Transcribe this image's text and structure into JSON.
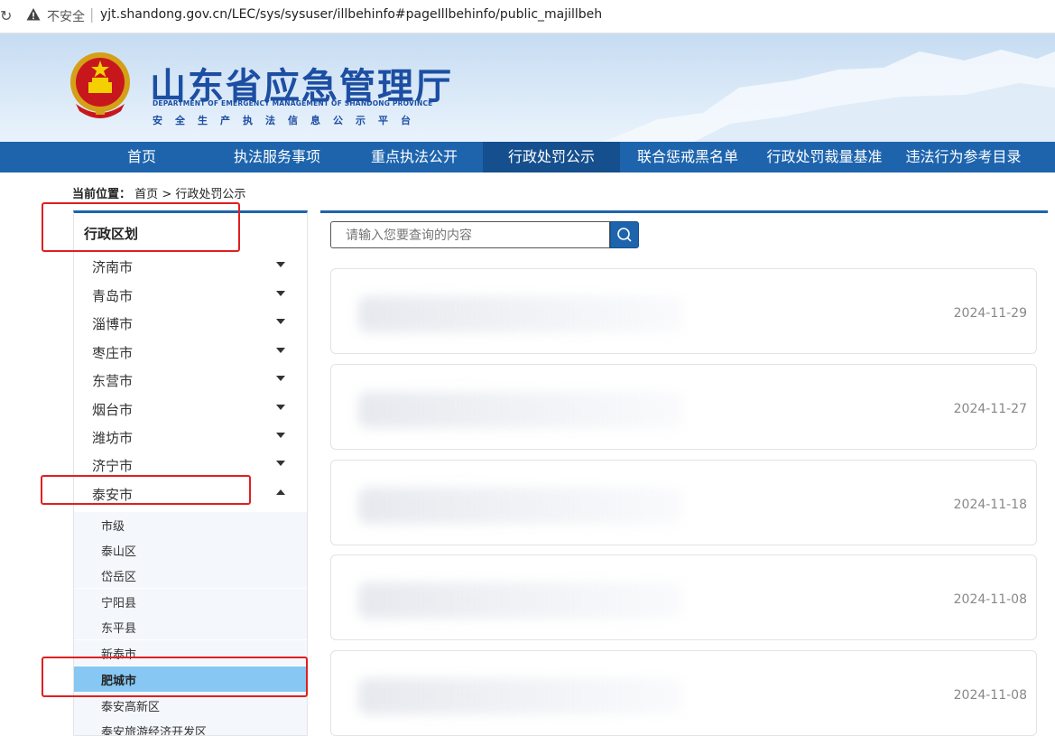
{
  "browser": {
    "insecure_label": "不安全",
    "separator": "|",
    "url": "yjt.shandong.gov.cn/LEC/sys/sysuser/illbehinfo#pageIllbehinfo/public_majillbeh"
  },
  "header": {
    "title": "山东省应急管理厅",
    "subtitle_en": "DEPARTMENT OF EMERGENCY MANAGEMENT OF SHANDONG PROVINCE",
    "subtitle_cn": "安全生产执法信息公示平台"
  },
  "nav": [
    {
      "label": "首页"
    },
    {
      "label": "执法服务事项"
    },
    {
      "label": "重点执法公开"
    },
    {
      "label": "行政处罚公示",
      "active": true
    },
    {
      "label": "联合惩戒黑名单"
    },
    {
      "label": "行政处罚裁量基准"
    },
    {
      "label": "违法行为参考目录"
    }
  ],
  "breadcrumb": {
    "prefix": "当前位置：",
    "home": "首页",
    "arrow": ">",
    "current": "行政处罚公示"
  },
  "sidebar": {
    "heading": "行政区划",
    "cities": [
      {
        "label": "济南市"
      },
      {
        "label": "青岛市"
      },
      {
        "label": "淄博市"
      },
      {
        "label": "枣庄市"
      },
      {
        "label": "东营市"
      },
      {
        "label": "烟台市"
      },
      {
        "label": "潍坊市"
      },
      {
        "label": "济宁市"
      },
      {
        "label": "泰安市",
        "expanded": true
      }
    ],
    "districts": [
      {
        "label": "市级"
      },
      {
        "label": "泰山区"
      },
      {
        "label": "岱岳区"
      },
      {
        "label": "宁阳县"
      },
      {
        "label": "东平县"
      },
      {
        "label": "新泰市"
      },
      {
        "label": "肥城市",
        "selected": true
      },
      {
        "label": "泰安高新区"
      },
      {
        "label": "泰安旅游经济开发区"
      }
    ]
  },
  "search": {
    "placeholder": "请输入您要查询的内容"
  },
  "records": [
    {
      "date": "2024-11-29"
    },
    {
      "date": "2024-11-27"
    },
    {
      "date": "2024-11-18"
    },
    {
      "date": "2024-11-08"
    },
    {
      "date": "2024-11-08"
    }
  ],
  "colors": {
    "nav_bg": "#1e64ad",
    "nav_active": "#154f8e",
    "selected_item": "#87c7f3",
    "annotation": "#e02020"
  }
}
